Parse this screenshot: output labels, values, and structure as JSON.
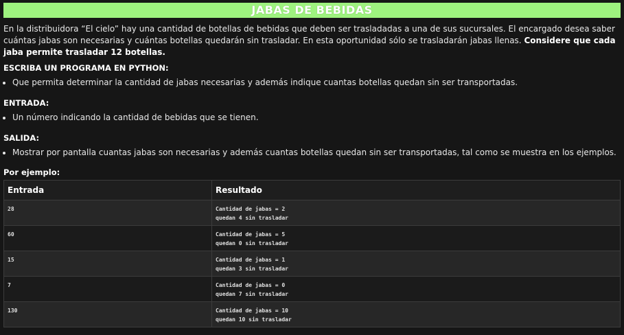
{
  "title": "JABAS DE BEBIDAS",
  "intro": {
    "text": "En la distribuidora “El cielo” hay una cantidad de botellas de bebidas que deben ser trasladadas a una de sus sucursales. El encargado desea saber cuántas jabas son necesarias y cuántas botellas quedarán sin trasladar. En esta oportunidad sólo se trasladarán jabas llenas. ",
    "bold_text": "Considere que cada jaba permite trasladar 12 botellas."
  },
  "sections": {
    "escriba": {
      "heading": "ESCRIBA UN PROGRAMA EN PYTHON:",
      "items": [
        "Que permita determinar la cantidad de jabas necesarias y además indique cuantas botellas quedan sin ser transportadas."
      ]
    },
    "entrada": {
      "heading": "ENTRADA:",
      "items": [
        "Un número indicando la cantidad de bebidas que se tienen."
      ]
    },
    "salida": {
      "heading": "SALIDA:",
      "items": [
        "Mostrar por pantalla cuantas jabas son necesarias y además cuantas botellas quedan sin ser transportadas, tal como se muestra en los ejemplos."
      ]
    },
    "ejemplo": {
      "heading": "Por ejemplo:"
    }
  },
  "table": {
    "headers": [
      "Entrada",
      "Resultado"
    ],
    "rows": [
      {
        "entrada": "28",
        "resultado": [
          "Cantidad de jabas = 2",
          "quedan 4 sin trasladar"
        ]
      },
      {
        "entrada": "60",
        "resultado": [
          "Cantidad de jabas = 5",
          "quedan 0 sin trasladar"
        ]
      },
      {
        "entrada": "15",
        "resultado": [
          "Cantidad de jabas = 1",
          "quedan 3 sin trasladar"
        ]
      },
      {
        "entrada": "7",
        "resultado": [
          "Cantidad de jabas = 0",
          "quedan 7 sin trasladar"
        ]
      },
      {
        "entrada": "130",
        "resultado": [
          "Cantidad de jabas = 10",
          "quedan 10 sin trasladar"
        ]
      }
    ]
  }
}
